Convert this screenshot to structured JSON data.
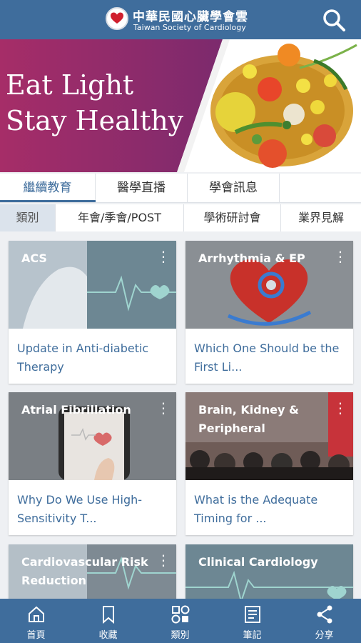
{
  "header": {
    "title_cn": "中華民國心臟學會雲",
    "title_en": "Taiwan Society of Cardiology",
    "logo_icon": "heart-logo-icon",
    "search_icon": "search-icon",
    "bg_color": "#3f6d9c"
  },
  "banner": {
    "line1": "Eat Light",
    "line2": "Stay Healthy",
    "bg_color": "#9b2e6c"
  },
  "tabs_primary": [
    {
      "label": "繼續教育",
      "active": true
    },
    {
      "label": "醫學直播",
      "active": false
    },
    {
      "label": "學會訊息",
      "active": false
    }
  ],
  "tabs_secondary": [
    {
      "label": "類別",
      "active": true
    },
    {
      "label": "年會/季會/POST",
      "active": false
    },
    {
      "label": "學術研討會",
      "active": false
    },
    {
      "label": "業界見解",
      "active": false
    }
  ],
  "cards": [
    {
      "category": "ACS",
      "title": "Update in Anti-diabetic Therapy"
    },
    {
      "category": "Arrhythmia & EP",
      "title": "Which One Should be the First Li..."
    },
    {
      "category": "Atrial Fibrillation",
      "title": "Why Do We Use High-Sensitivity T..."
    },
    {
      "category": "Brain, Kidney & Peripheral",
      "title": "What is the Adequate Timing for ..."
    },
    {
      "category": "Cardiovascular Risk Reduction",
      "title": ""
    },
    {
      "category": "Clinical Cardiology",
      "title": ""
    }
  ],
  "bottom_nav": [
    {
      "label": "首頁",
      "icon": "home-icon"
    },
    {
      "label": "收藏",
      "icon": "bookmark-icon"
    },
    {
      "label": "類別",
      "icon": "category-icon"
    },
    {
      "label": "筆記",
      "icon": "notes-icon"
    },
    {
      "label": "分享",
      "icon": "share-icon"
    }
  ]
}
